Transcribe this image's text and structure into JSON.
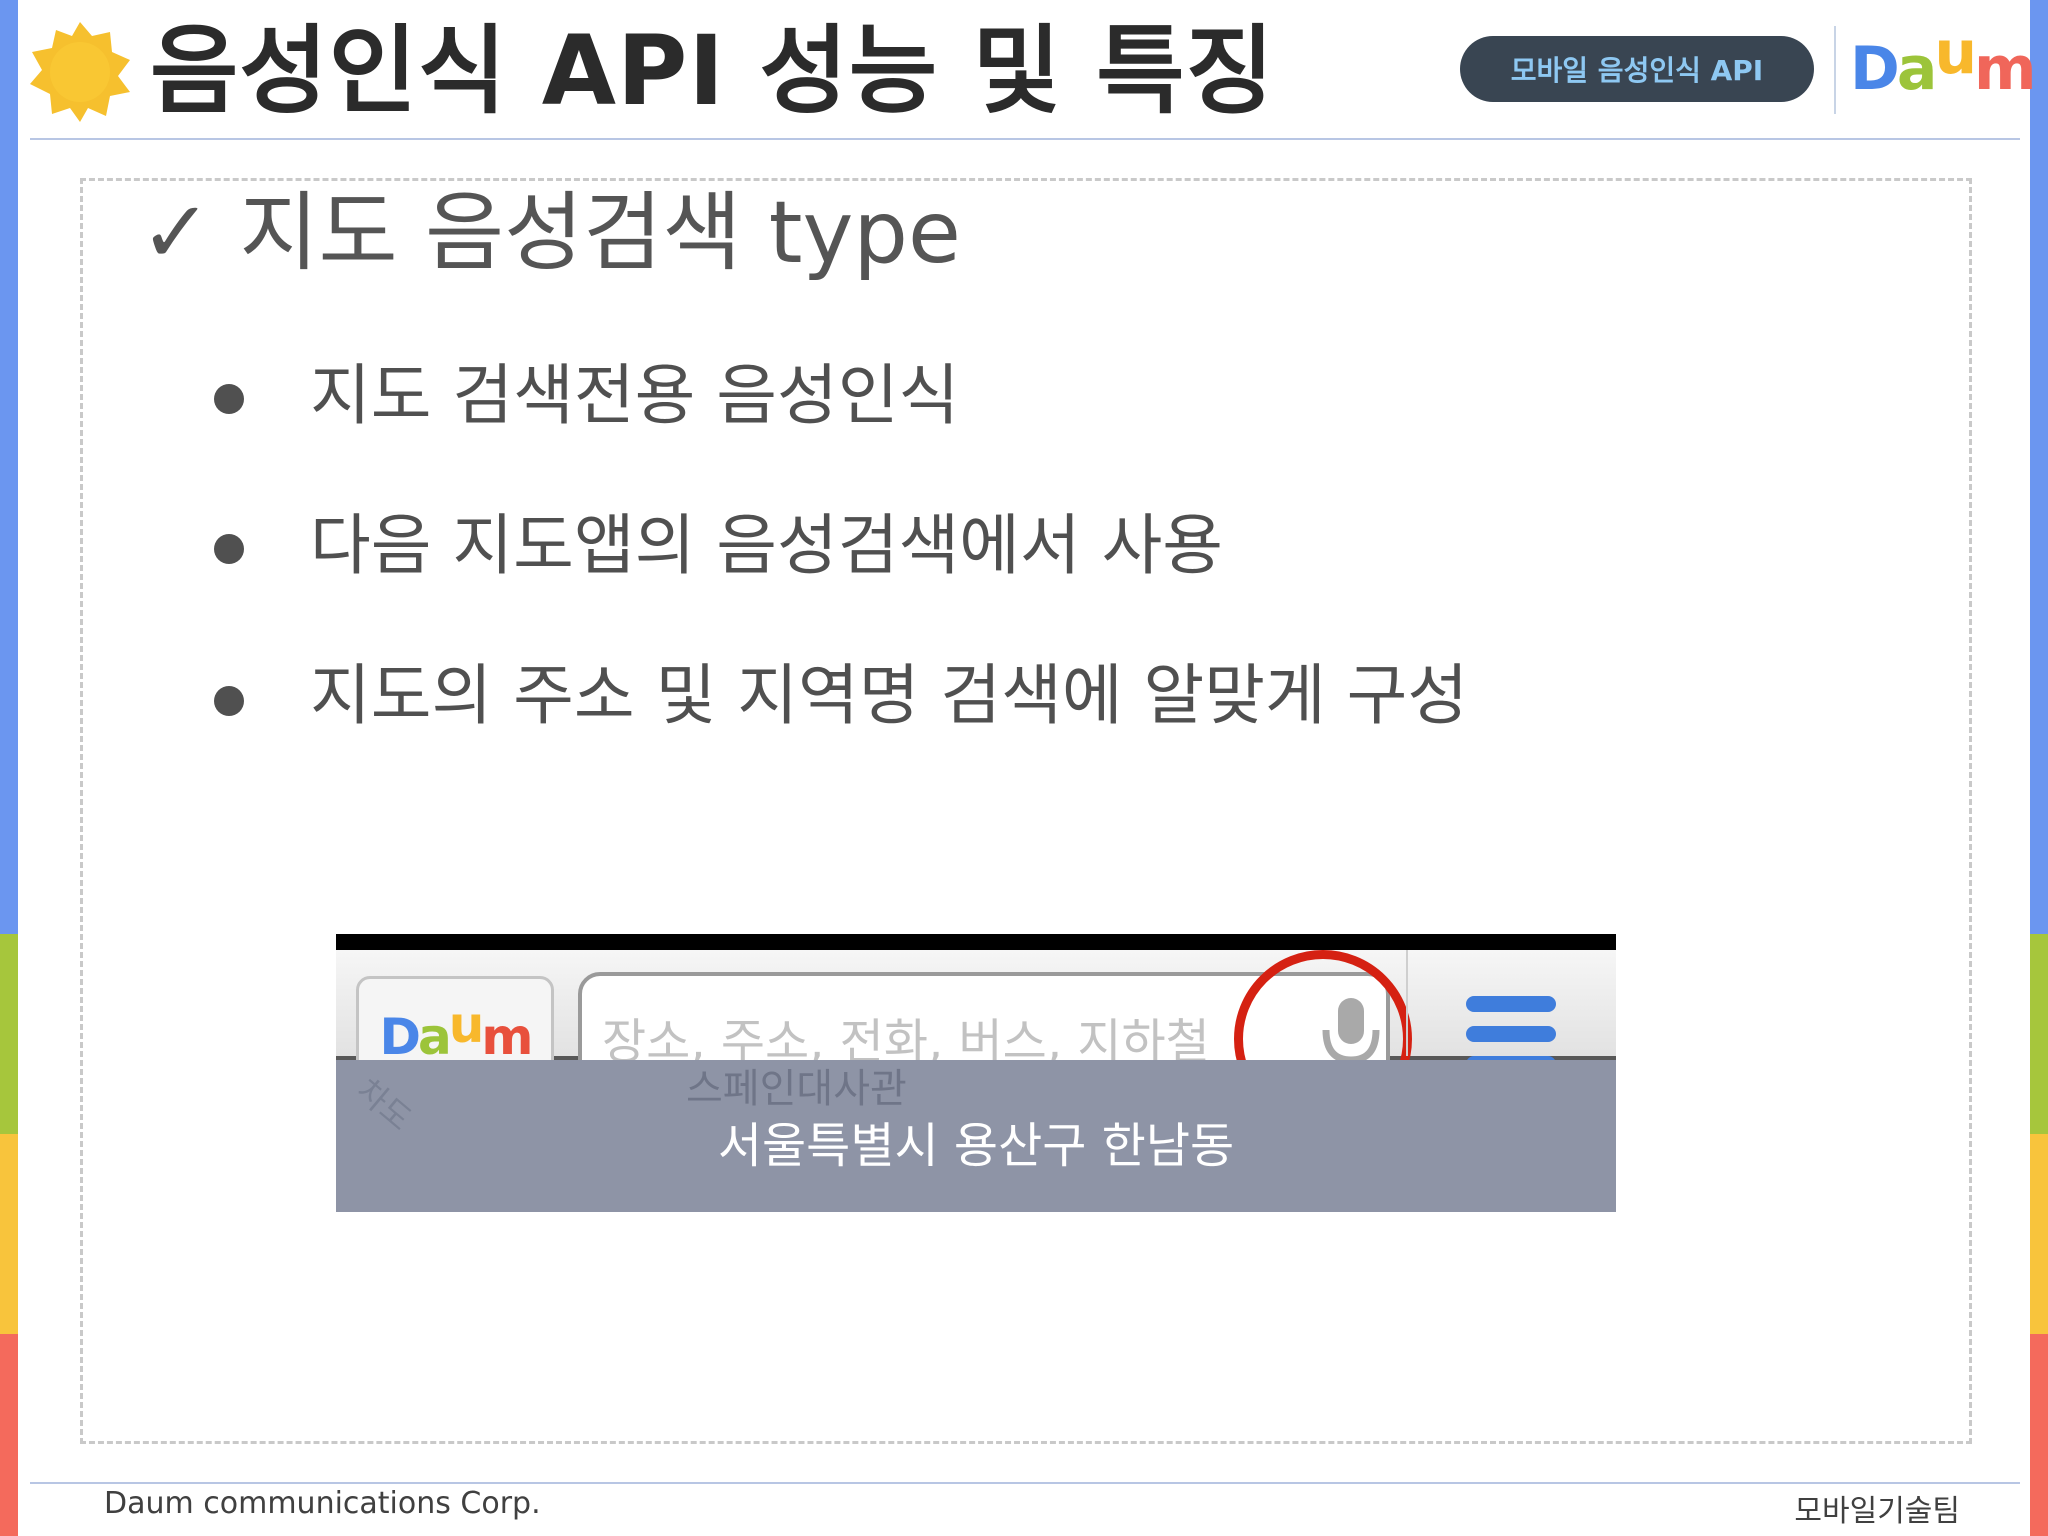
{
  "header": {
    "title": "음성인식 API 성능 및 특징",
    "badge": "모바일 음성인식 API",
    "logo": {
      "d": "D",
      "a": "a",
      "u": "u",
      "m": "m"
    }
  },
  "content": {
    "heading": "✓ 지도 음성검색 type",
    "bullets": [
      "지도 검색전용 음성인식",
      "다음 지도앱의 음성검색에서 사용",
      "지도의 주소 및 지역명 검색에 알맞게 구성"
    ]
  },
  "screenshot": {
    "logo": {
      "d": "D",
      "a": "a",
      "u": "u",
      "m": "m"
    },
    "search_placeholder": "장소, 주소, 전화, 버스, 지하철",
    "map_label_faint": "스페인대사관",
    "map_label_street": "차도",
    "address": "서울특별시 용산구 한남동"
  },
  "footer": {
    "left": "Daum communications Corp.",
    "right": "모바일기술팀"
  },
  "colors": {
    "blue": "#6b96f0",
    "green": "#a6c63c",
    "yellow": "#f8c43c",
    "red": "#f46a5c",
    "highlight_ring": "#d52112",
    "menu_icon": "#3f7ddc"
  }
}
